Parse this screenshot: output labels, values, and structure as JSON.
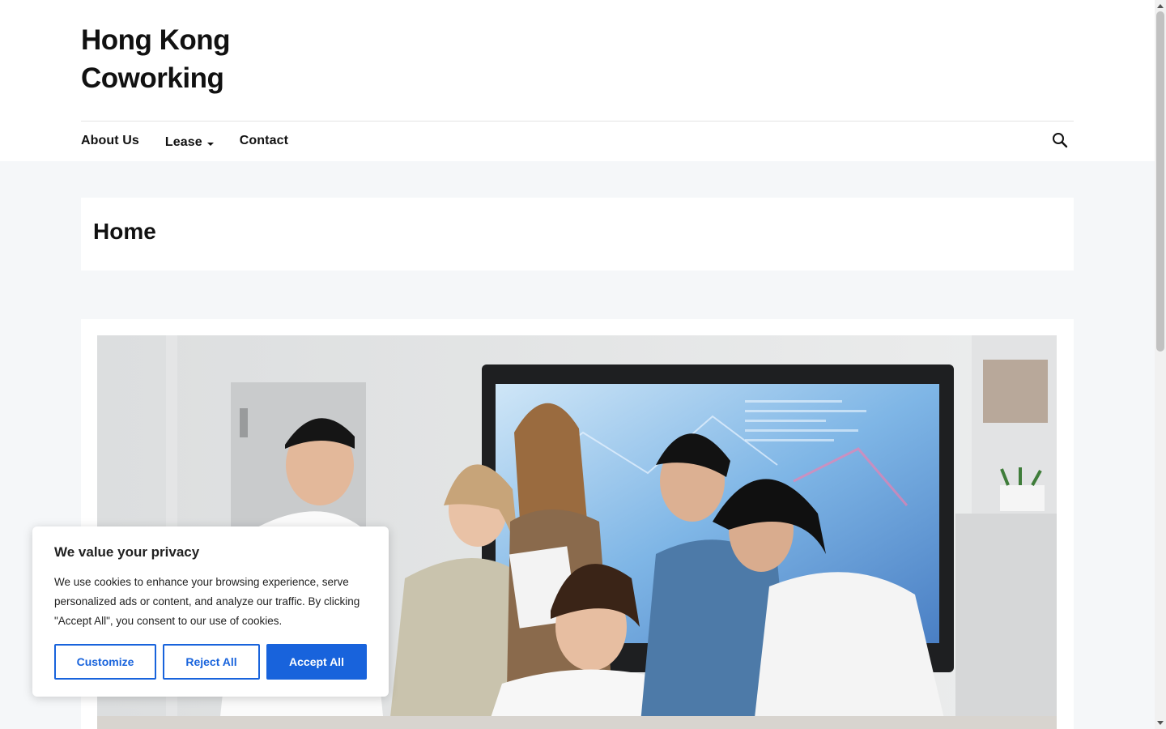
{
  "header": {
    "site_title": "Hong Kong Coworking"
  },
  "nav": {
    "items": [
      {
        "label": "About Us"
      },
      {
        "label": "Lease"
      },
      {
        "label": "Contact"
      }
    ]
  },
  "page": {
    "title": "Home"
  },
  "icons": {
    "search": "search-icon",
    "dropdown": "caret-down-icon"
  },
  "cookie_banner": {
    "title": "We value your privacy",
    "body": "We use cookies to enhance your browsing experience, serve personalized ads or content, and analyze our traffic. By clicking \"Accept All\", you consent to our use of cookies.",
    "customize_label": "Customize",
    "reject_label": "Reject All",
    "accept_label": "Accept All"
  },
  "colors": {
    "accent": "#1863dc",
    "page_background": "#f5f7f9",
    "surface": "#ffffff",
    "text": "#111111"
  }
}
